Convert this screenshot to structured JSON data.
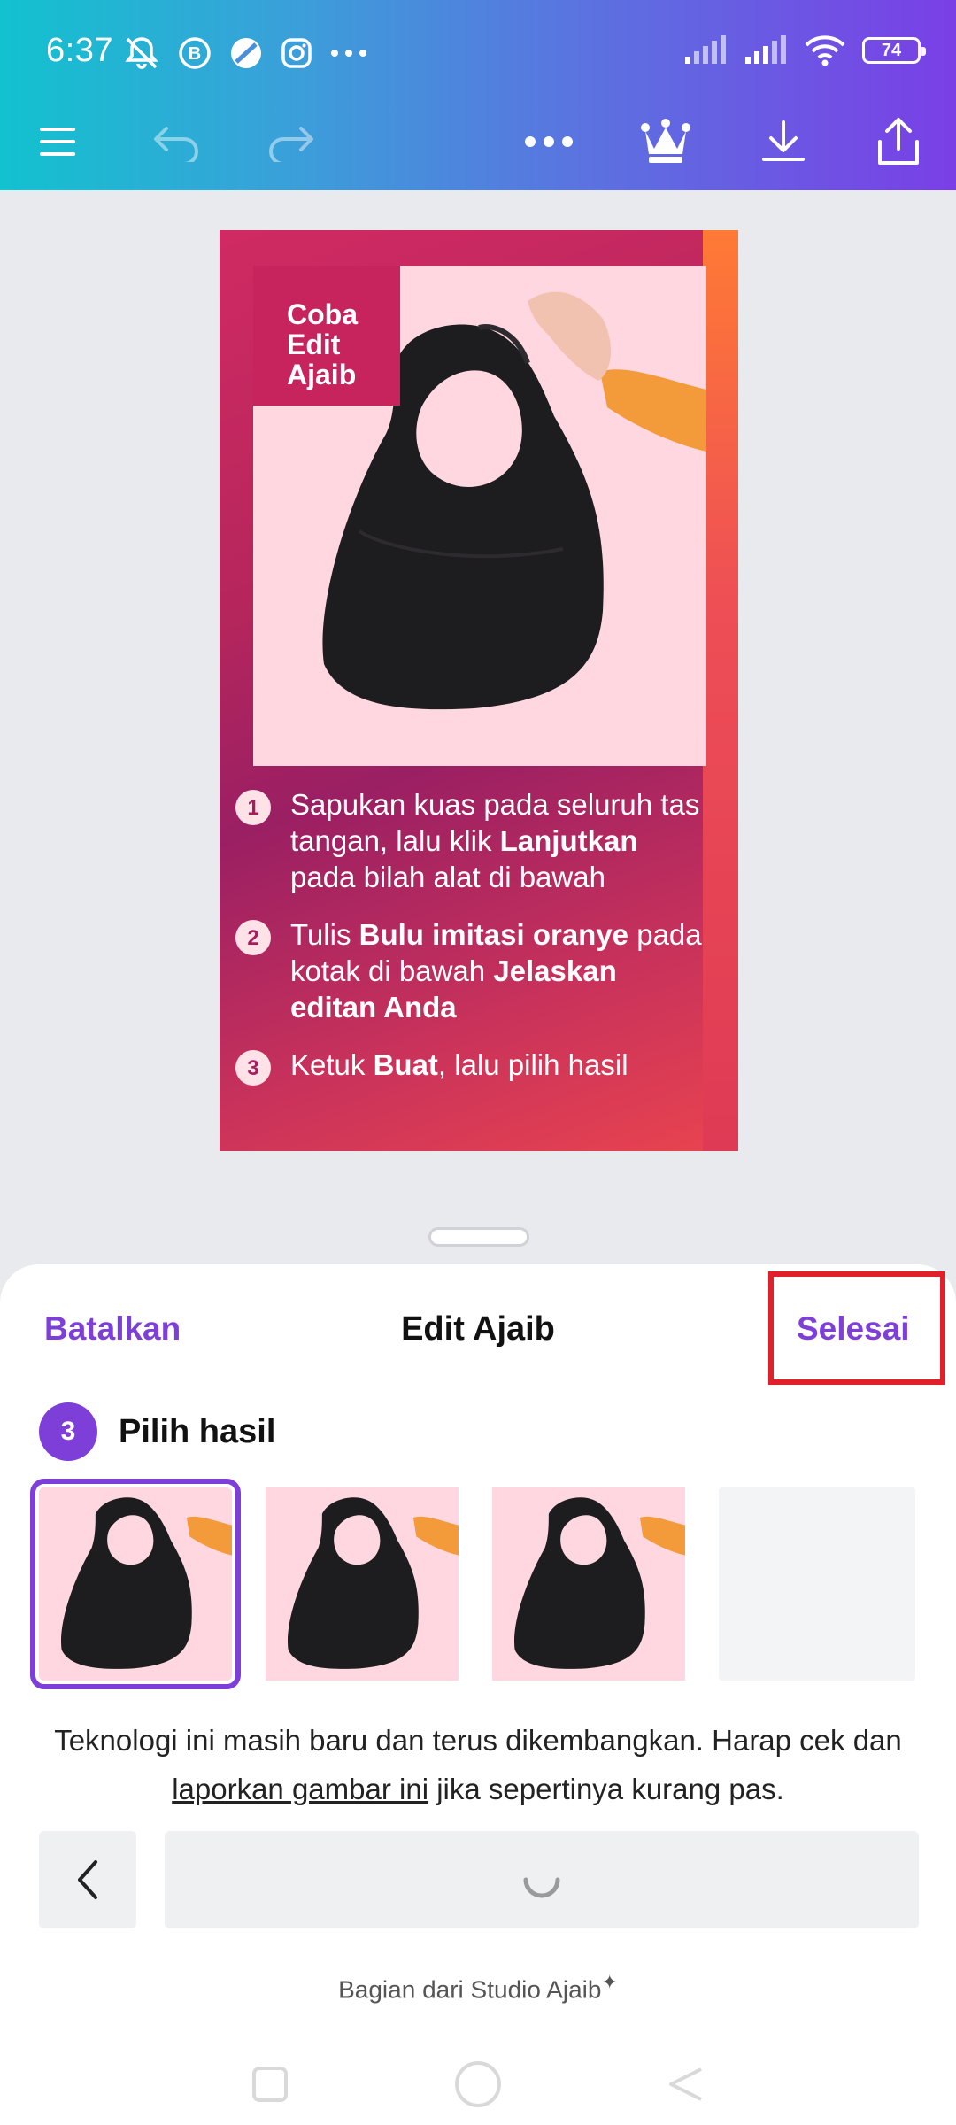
{
  "status_bar": {
    "time": "6:37",
    "battery": "74",
    "left_icons": [
      "notifications-off-icon",
      "b-app-icon",
      "app-circle-icon",
      "instagram-icon",
      "more-dots-icon"
    ],
    "right_icons": [
      "signal-1-icon",
      "signal-2-icon",
      "wifi-icon",
      "battery-icon"
    ]
  },
  "toolbar": {
    "icons": [
      "menu-icon",
      "undo-icon",
      "redo-icon",
      "more-icon",
      "crown-icon",
      "download-icon",
      "share-icon"
    ]
  },
  "design": {
    "tag": "Coba Edit Ajaib",
    "steps": [
      {
        "num": "1",
        "pre": "Sapukan kuas pada seluruh tas tangan, lalu klik ",
        "bold": "Lanjutkan",
        "post": " pada bilah alat di bawah"
      },
      {
        "num": "2",
        "pre": "Tulis ",
        "bold": "Bulu imitasi oranye",
        "mid": " pada kotak di bawah ",
        "bold2": "Jelaskan editan Anda"
      },
      {
        "num": "3",
        "pre": "Ketuk ",
        "bold": "Buat",
        "post": ", lalu pilih hasil"
      }
    ]
  },
  "sheet": {
    "cancel_label": "Batalkan",
    "title": "Edit Ajaib",
    "done_label": "Selesai",
    "step_number": "3",
    "step_label": "Pilih hasil",
    "disclaimer_before": "Teknologi ini masih baru dan terus dikembangkan. Harap cek dan ",
    "disclaimer_link": "laporkan gambar ini",
    "disclaimer_after": " jika sepertinya kurang pas.",
    "footer": "Bagian dari Studio Ajaib",
    "footer_mark": "✦"
  },
  "colors": {
    "accent": "#7d3fd7",
    "highlight": "#e0202a",
    "photo_bg": "#ffd7e0"
  }
}
